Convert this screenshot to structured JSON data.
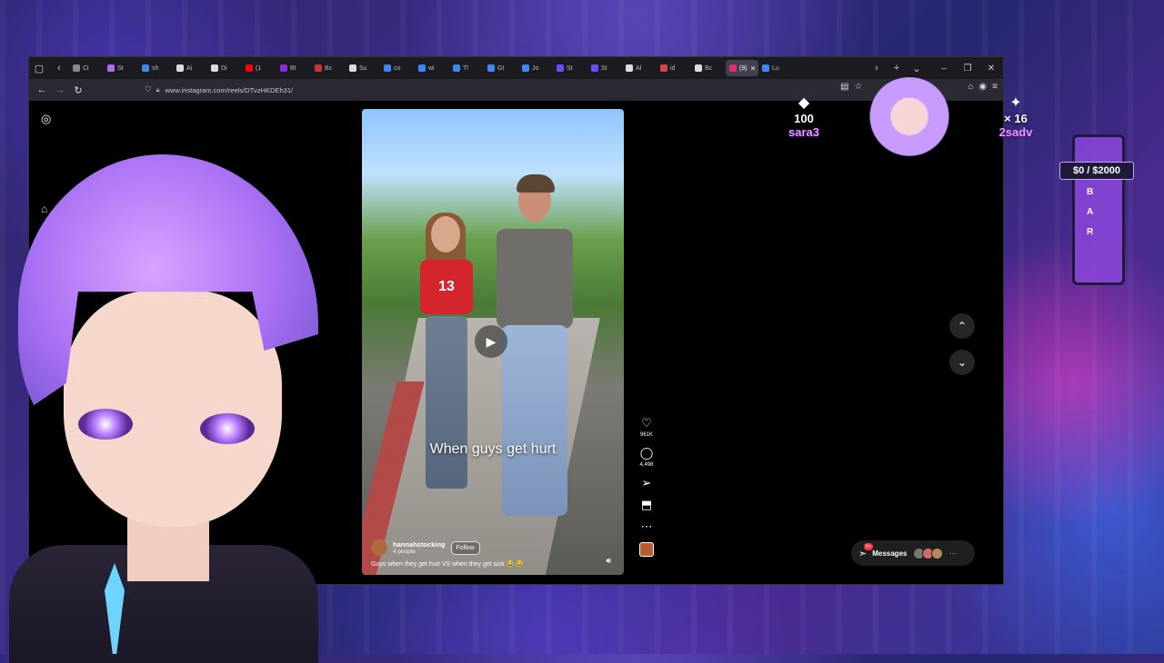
{
  "browser": {
    "tabs": [
      {
        "label": "Cl",
        "color": "#888888"
      },
      {
        "label": "St",
        "color": "#b06aff"
      },
      {
        "label": "sh",
        "color": "#4285f4"
      },
      {
        "label": "Ai",
        "color": "#dddddd"
      },
      {
        "label": "Di",
        "color": "#dddddd"
      },
      {
        "label": "(1",
        "color": "#ff0000"
      },
      {
        "label": "Bt",
        "color": "#8a2be2"
      },
      {
        "label": "Bc",
        "color": "#cc3333"
      },
      {
        "label": "Su",
        "color": "#dddddd"
      },
      {
        "label": "co",
        "color": "#4285f4"
      },
      {
        "label": "wi",
        "color": "#4285f4"
      },
      {
        "label": "Tl",
        "color": "#4285f4"
      },
      {
        "label": "Gt",
        "color": "#4285f4"
      },
      {
        "label": "Jo",
        "color": "#4285f4"
      },
      {
        "label": "St",
        "color": "#6b4cff"
      },
      {
        "label": "St",
        "color": "#6b4cff"
      },
      {
        "label": "Al",
        "color": "#dddddd"
      },
      {
        "label": "id",
        "color": "#dd4444"
      },
      {
        "label": "Bc",
        "color": "#dddddd"
      },
      {
        "label": "(9)",
        "color": "#e1306c",
        "active": true
      },
      {
        "label": "Lu",
        "color": "#4285f4"
      }
    ],
    "url": "www.instagram.com/reels/DTvzHKDEh31/"
  },
  "reel": {
    "caption": "When guys get hurt",
    "author": "hannahstocking",
    "people": "4 people",
    "follow": "Follow",
    "description": "Guys when they get hurt VS when they get sick 😂 😂",
    "shirt_number": "13",
    "likes": "961K",
    "comments": "4,498"
  },
  "messages": {
    "label": "Messages",
    "badge": "9+"
  },
  "overlay": {
    "stat1_num": "100",
    "stat1_user": "sara3",
    "stat2_num": "× 16",
    "stat2_user": "2sadv",
    "bar_money": "$0 / $2000",
    "bar_letters": [
      "B",
      "A",
      "R"
    ]
  },
  "colors": {
    "accent": "#e79bff",
    "badge": "#ff3040",
    "browser_chrome": "#2b2a33"
  }
}
